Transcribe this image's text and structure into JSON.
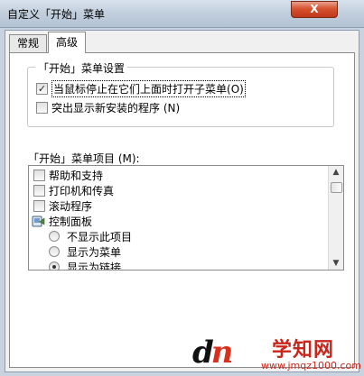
{
  "window": {
    "title": "自定义「开始」菜单",
    "close_glyph": "X"
  },
  "tabs": [
    {
      "label": "常规",
      "active": false
    },
    {
      "label": "高级",
      "active": true
    }
  ],
  "settings_group": {
    "legend": "「开始」菜单设置",
    "options": [
      {
        "label": "当鼠标停止在它们上面时打开子菜单",
        "hotkey": "(O)",
        "checked": true
      },
      {
        "label": "突出显示新安装的程序",
        "hotkey": "(N)",
        "checked": false
      }
    ]
  },
  "items_section": {
    "label": "「开始」菜单项目 (M):",
    "items": [
      {
        "type": "checkbox",
        "label": "帮助和支持",
        "checked": false
      },
      {
        "type": "checkbox",
        "label": "打印机和传真",
        "checked": false
      },
      {
        "type": "checkbox",
        "label": "滚动程序",
        "checked": false
      },
      {
        "type": "group-icon",
        "label": "控制面板",
        "icon": "control-panel-icon"
      },
      {
        "type": "radio",
        "label": "不显示此项目",
        "selected": false
      },
      {
        "type": "radio",
        "label": "显示为菜单",
        "selected": false
      },
      {
        "type": "radio",
        "label": "显示为链接",
        "selected": true
      }
    ]
  },
  "watermark": {
    "logo_text_1": "d",
    "logo_text_2": "n",
    "site_name": "学知网",
    "url": "www.jmqz1000.com"
  },
  "colors": {
    "close_button": "#d6532f",
    "watermark_red": "#c8261c"
  }
}
